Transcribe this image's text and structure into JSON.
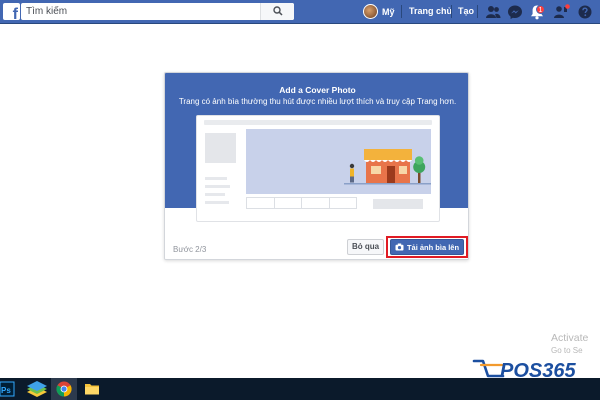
{
  "topbar": {
    "logo_letter": "f",
    "search": {
      "placeholder": "Tìm kiếm"
    },
    "icons": [
      "search-icon",
      "friends-icon",
      "messenger-icon",
      "notifications-icon",
      "page-manager-icon",
      "help-icon"
    ],
    "profile_name": "Mỹ",
    "nav": {
      "home": "Trang chủ",
      "create": "Tạo"
    },
    "notification_count": "1"
  },
  "dialog": {
    "title": "Add a Cover Photo",
    "subtitle": "Trang có ảnh bìa thường thu hút được nhiều lượt thích và truy cập Trang hơn.",
    "step": "Bước 2/3",
    "skip_label": "Bỏ qua",
    "upload_label": "Tải ảnh bìa lên",
    "upload_icon": "camera-icon"
  },
  "watermark": {
    "activate_title": "Activate",
    "activate_sub": "Go to Se",
    "brand": "POS365"
  },
  "taskbar": {
    "apps": [
      "photoshop-icon",
      "bluestacks-icon",
      "chrome-icon",
      "file-explorer-icon"
    ],
    "ps_label": "Ps"
  },
  "colors": {
    "facebook_blue": "#4267b2",
    "highlight_red": "#e01b24",
    "cover_fill": "#c8d1ea",
    "brand_blue": "#1c4fa0"
  }
}
